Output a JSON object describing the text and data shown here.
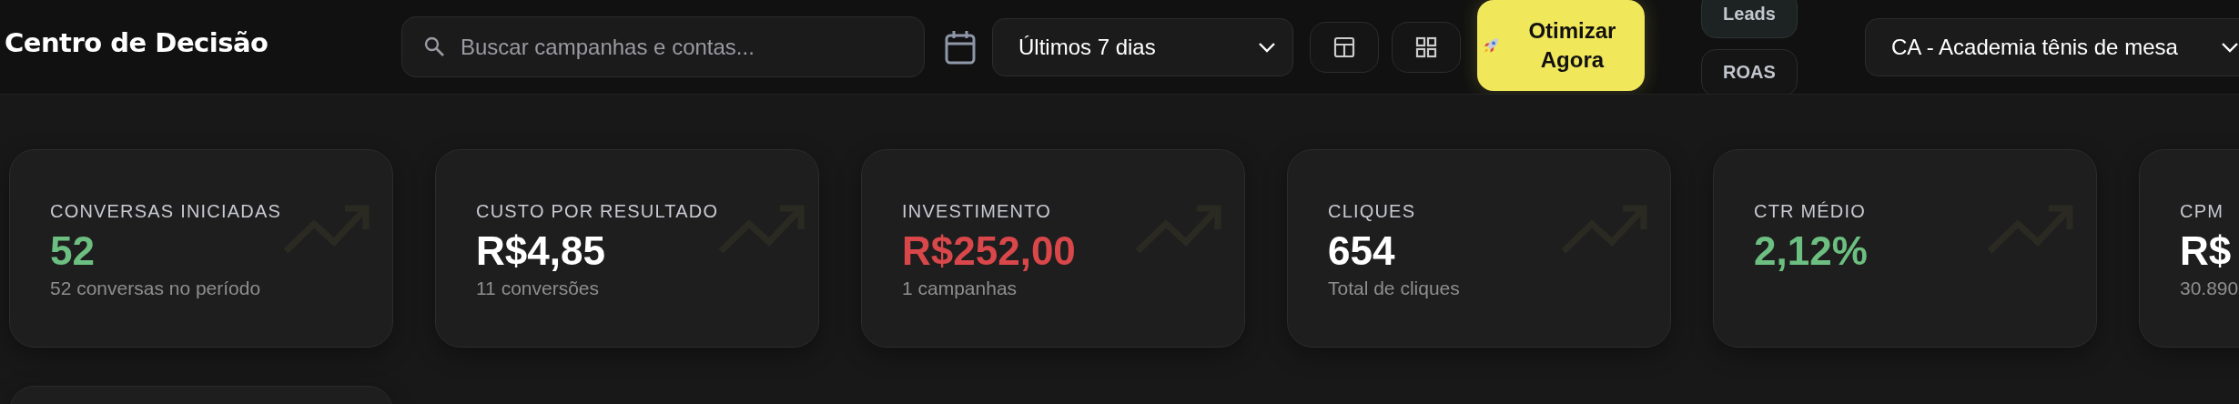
{
  "header": {
    "title": "Centro de Decisão",
    "search": {
      "placeholder": "Buscar campanhas e contas..."
    },
    "period": {
      "value": "Últimos 7 dias"
    },
    "optimize_button": "Otimizar Agora",
    "metric_toggles": [
      {
        "label": "Leads",
        "selected": true
      },
      {
        "label": "ROAS",
        "selected": false
      }
    ],
    "account": {
      "value": "CA - Academia tênis de mesa"
    }
  },
  "cards": [
    {
      "kind": "metric",
      "label": "CONVERSAS INICIADAS",
      "value": "52",
      "color": "#6cbf80",
      "trend": true,
      "subtitle": "52 conversas no período"
    },
    {
      "kind": "metric",
      "label": "CUSTO POR RESULTADO",
      "value": "R$4,85",
      "color": "#ffffff",
      "trend": true,
      "subtitle": "11 conversões"
    },
    {
      "kind": "metric",
      "label": "INVESTIMENTO",
      "value": "R$252,00",
      "color": "#d9474a",
      "trend": true,
      "subtitle": "1 campanhas"
    },
    {
      "kind": "metric",
      "label": "CLIQUES",
      "value": "654",
      "color": "#ffffff",
      "trend": true,
      "subtitle": "Total de cliques"
    },
    {
      "kind": "metric",
      "label": "CTR MÉDIO",
      "value": "2,12%",
      "color": "#6cbf80",
      "trend": true
    },
    {
      "kind": "metric",
      "label": "CPM",
      "value": "R$",
      "color": "#ffffff",
      "subtitle": "30.890"
    },
    {
      "kind": "empty"
    }
  ]
}
